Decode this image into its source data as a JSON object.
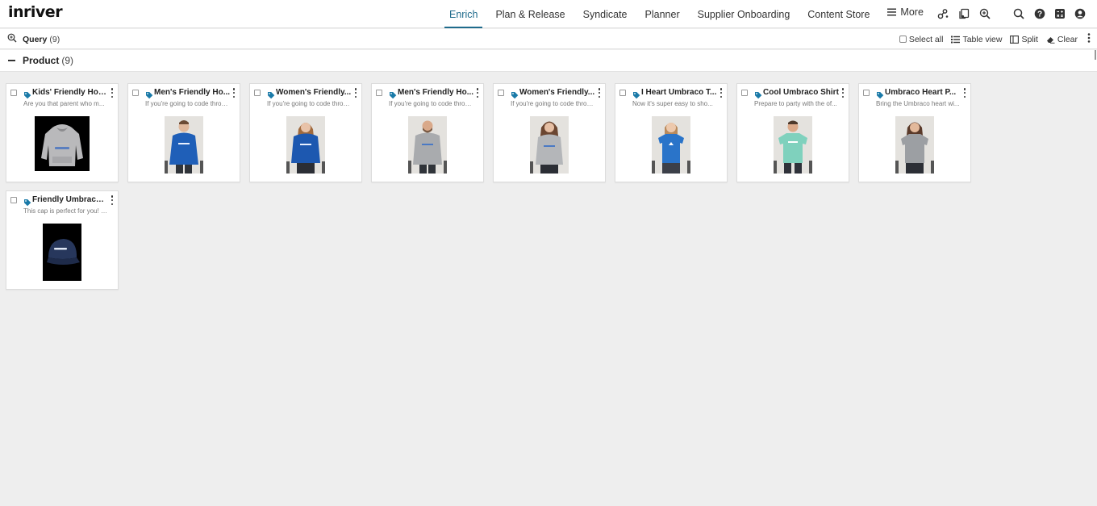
{
  "app": {
    "logo_text": "inriver"
  },
  "nav": {
    "items": [
      {
        "label": "Enrich",
        "active": true
      },
      {
        "label": "Plan & Release",
        "active": false
      },
      {
        "label": "Syndicate",
        "active": false
      },
      {
        "label": "Planner",
        "active": false
      },
      {
        "label": "Supplier Onboarding",
        "active": false
      },
      {
        "label": "Content Store",
        "active": false
      }
    ],
    "more_label": "More",
    "icons": [
      "flows-icon",
      "notes-icon",
      "zoom-search-icon",
      "search-icon",
      "help-icon",
      "calculator-icon",
      "user-icon"
    ]
  },
  "querybar": {
    "label": "Query",
    "count": "(9)",
    "select_all": "Select all",
    "table_view": "Table view",
    "split": "Split",
    "clear": "Clear"
  },
  "section": {
    "title": "Product",
    "count": "(9)"
  },
  "colors": {
    "accent": "#1f6b8c",
    "tag": "#1a7aa8",
    "background": "#eeeeee"
  },
  "cards": [
    {
      "title": "Kids' Friendly Hoo...",
      "desc": "Are you that parent who m...",
      "image": "grey-hoodie-product"
    },
    {
      "title": "Men's Friendly Ho...",
      "desc": "If you're going to code throu...",
      "image": "man-blue-hoodie"
    },
    {
      "title": "Women's Friendly...",
      "desc": "If you're going to code throu...",
      "image": "woman-blue-hoodie"
    },
    {
      "title": "Men's Friendly Ho...",
      "desc": "If you're going to code throu...",
      "image": "man-grey-hoodie"
    },
    {
      "title": "Women's Friendly...",
      "desc": "If you're going to code throu...",
      "image": "woman-grey-hoodie"
    },
    {
      "title": "I Heart Umbraco T...",
      "desc": "Now it's super easy to sho...",
      "image": "woman-blue-tshirt"
    },
    {
      "title": "Cool Umbraco Shirt",
      "desc": "Prepare to party with the of...",
      "image": "man-teal-shirt"
    },
    {
      "title": "Umbraco Heart P...",
      "desc": "Bring the Umbraco heart wi...",
      "image": "woman-grey-shirt"
    },
    {
      "title": "Friendly Umbraco ...",
      "desc": "This cap is perfect for you! It...",
      "image": "navy-cap-product"
    }
  ]
}
